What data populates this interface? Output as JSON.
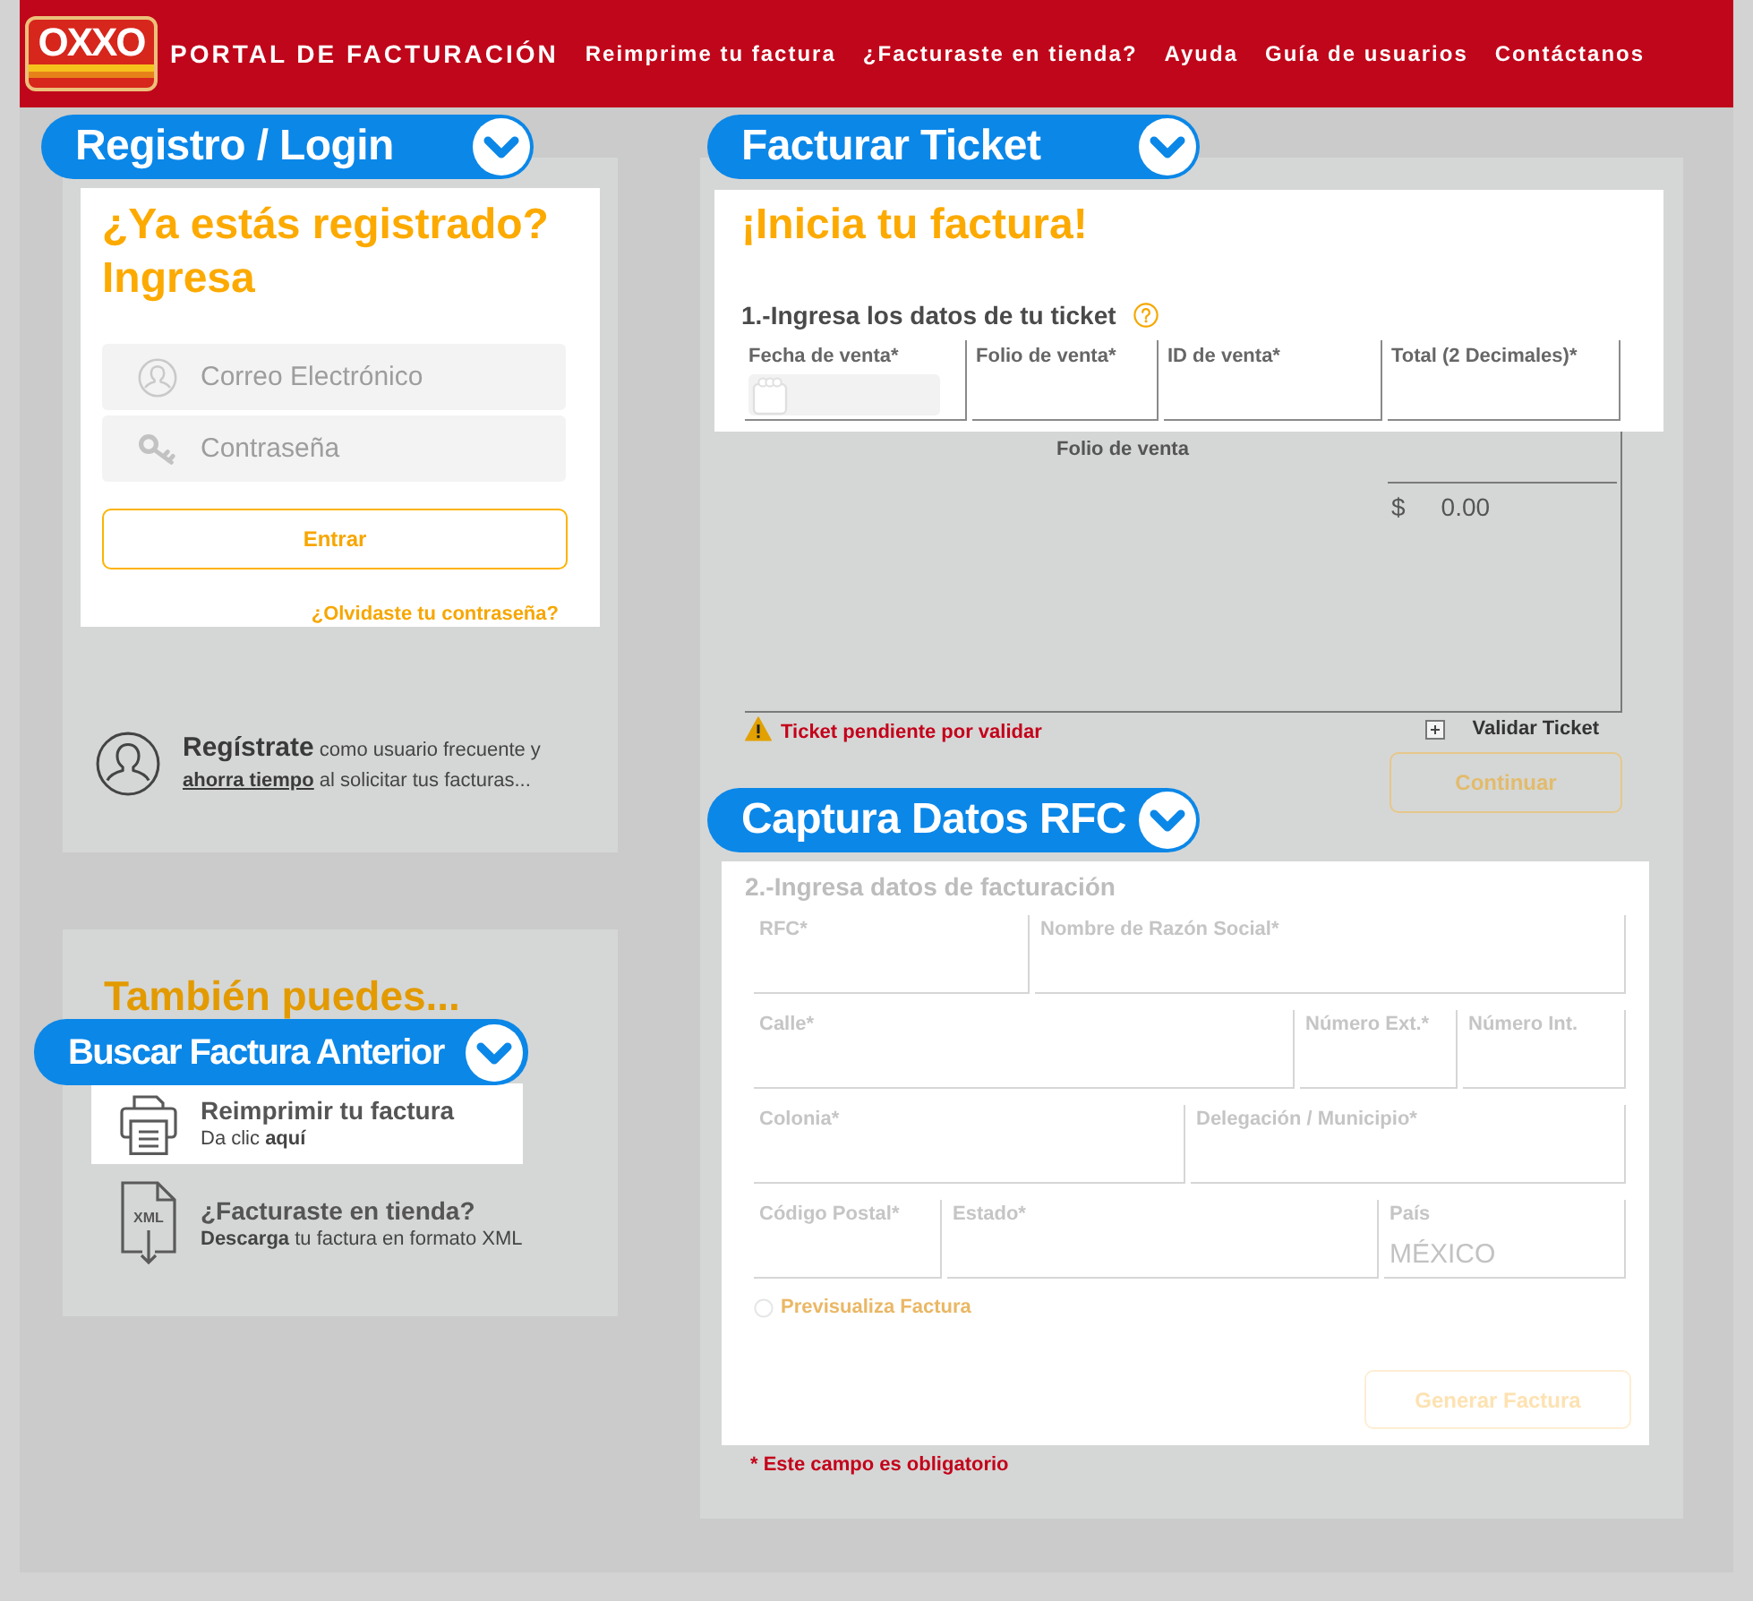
{
  "header": {
    "logo": "OXXO",
    "title": "PORTAL DE FACTURACIÓN",
    "nav": [
      "Reimprime tu factura",
      "¿Facturaste en tienda?",
      "Ayuda",
      "Guía de usuarios",
      "Contáctanos"
    ]
  },
  "login": {
    "tab": "Registro / Login",
    "heading": "¿Ya estás registrado?",
    "subheading": "Ingresa",
    "fields": [
      {
        "kind": "email",
        "placeholder": "Correo Electrónico"
      },
      {
        "kind": "password",
        "placeholder": "Contraseña"
      }
    ],
    "button": "Entrar",
    "forgot_link": "¿Olvidaste tu contraseña?",
    "register": {
      "lead": "Regístrate",
      "text": "como usuario frecuente y",
      "link": "ahorra tiempo",
      "tail": "al solicitar tus facturas..."
    }
  },
  "more": {
    "heading": "También puedes...",
    "tab": "Buscar Factura Anterior",
    "options": [
      {
        "kind": "reprint",
        "title": "Reimprimir tu factura",
        "text": "Da clic **aquí**",
        "selected": true
      },
      {
        "kind": "xml",
        "icon_text": "XML",
        "title": "¿Facturaste en tienda?",
        "text": "**Descarga** tu factura en formato XML",
        "selected": false
      }
    ]
  },
  "ticket": {
    "tab": "Facturar Ticket",
    "heading": "¡Inicia tu factura!",
    "step": "1.-Ingresa los datos de tu ticket",
    "fields": [
      {
        "kind": "date",
        "label": "Fecha de venta*"
      },
      {
        "kind": "text",
        "label": "Folio de venta*"
      },
      {
        "kind": "text",
        "label": "ID de venta*"
      },
      {
        "kind": "text",
        "label": "Total (2 Decimales)*"
      }
    ],
    "summary": {
      "column": "Folio de venta",
      "currency": "$",
      "total": "0.00"
    },
    "status": "Ticket pendiente por validar",
    "validate": "Validar Ticket",
    "button": {
      "label": "Continuar",
      "disabled": true
    }
  },
  "billing": {
    "tab": "Captura Datos RFC",
    "disabled": true,
    "step": "2.-Ingresa datos de facturación",
    "rows": [
      {
        "fields": [
          {
            "label": "RFC*"
          },
          {
            "label": "Nombre de Razón Social*"
          }
        ]
      },
      {
        "fields": [
          {
            "label": "Calle*"
          },
          {
            "label": "Número Ext.*"
          },
          {
            "label": "Número Int."
          }
        ]
      },
      {
        "fields": [
          {
            "label": "Colonia*"
          },
          {
            "label": "Delegación / Municipio*"
          }
        ]
      },
      {
        "fields": [
          {
            "label": "Código Postal*"
          },
          {
            "label": "Estado*"
          },
          {
            "label": "País",
            "value": "MÉXICO"
          }
        ]
      }
    ],
    "preview": {
      "label": "Previsualiza Factura",
      "checked": false
    },
    "button": {
      "label": "Generar Factura",
      "disabled": true
    },
    "note": "* Este campo es obligatorio"
  }
}
